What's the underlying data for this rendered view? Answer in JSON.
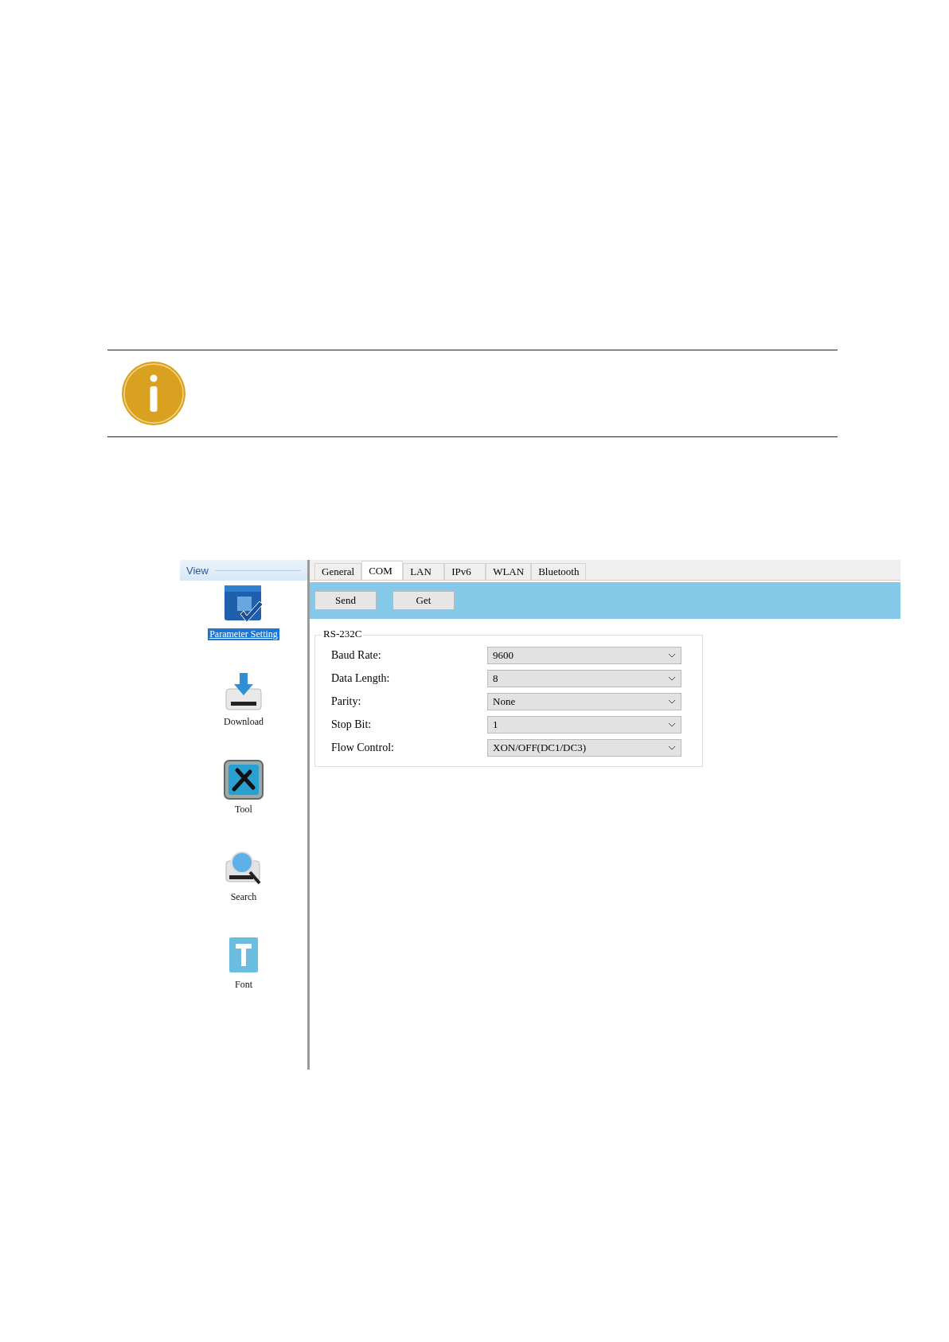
{
  "sidebar": {
    "header": "View",
    "items": [
      {
        "label": "Parameter Setting",
        "kind": "parameter",
        "selected": true
      },
      {
        "label": "Download",
        "kind": "download",
        "selected": false
      },
      {
        "label": "Tool",
        "kind": "tool",
        "selected": false
      },
      {
        "label": "Search",
        "kind": "search",
        "selected": false
      },
      {
        "label": "Font",
        "kind": "font",
        "selected": false
      }
    ]
  },
  "tabs": [
    {
      "label": "General",
      "selected": false
    },
    {
      "label": "COM",
      "selected": true
    },
    {
      "label": "LAN",
      "selected": false
    },
    {
      "label": "IPv6",
      "selected": false
    },
    {
      "label": "WLAN",
      "selected": false
    },
    {
      "label": "Bluetooth",
      "selected": false
    }
  ],
  "toolbar": {
    "buttons": [
      "Send",
      "Get"
    ]
  },
  "group": {
    "title": "RS-232C",
    "fields": [
      {
        "label": "Baud Rate:",
        "value": "9600"
      },
      {
        "label": "Data Length:",
        "value": "8"
      },
      {
        "label": "Parity:",
        "value": "None"
      },
      {
        "label": "Stop Bit:",
        "value": "1"
      },
      {
        "label": "Flow Control:",
        "value": "XON/OFF(DC1/DC3)"
      }
    ]
  }
}
